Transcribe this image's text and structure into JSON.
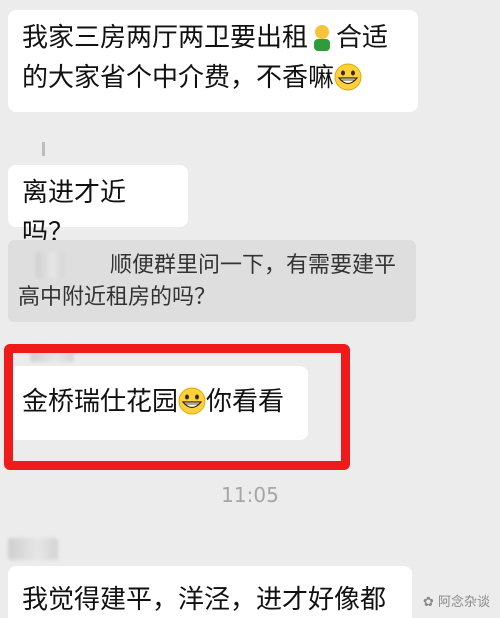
{
  "messages": {
    "m1_line1_a": "我家三房两厅两卫要出租",
    "m1_line1_b": "合适",
    "m1_line2": "的大家省个中介费，不香嘛",
    "m2": "离进才近吗？",
    "quote_line1": "顺便群里问一下，有需要建平",
    "quote_line2": "高中附近租房的吗？",
    "m3_a": "金桥瑞仕花园",
    "m3_b": "你看看",
    "time": "11:05",
    "m4": "我觉得建平，洋泾，进才好像都"
  },
  "watermark": "阿念杂谈",
  "colors": {
    "highlight": "#ef1b1b",
    "background": "#ececec"
  },
  "icons": [
    "person-emoji-icon",
    "grinning-emoji-icon",
    "grinning-emoji-icon"
  ]
}
